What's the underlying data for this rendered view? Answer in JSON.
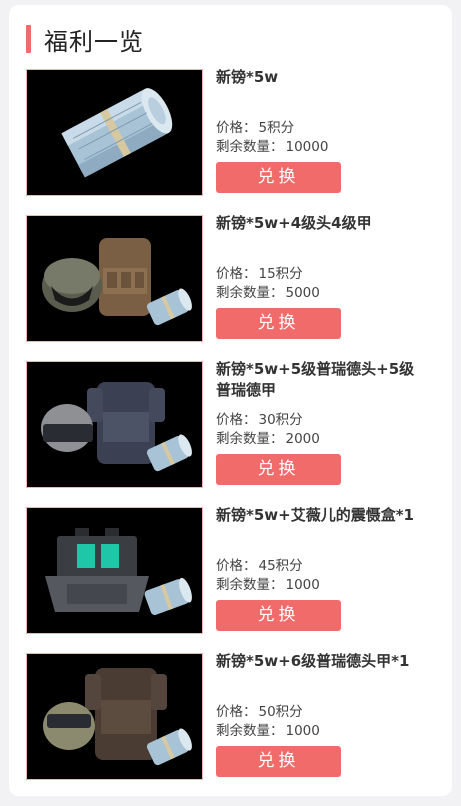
{
  "header": {
    "title": "福利一览"
  },
  "labels": {
    "price": "价格：",
    "stock": "剩余数量："
  },
  "items": [
    {
      "name": "新镑*5w",
      "price": "5积分",
      "stock": "10000",
      "button": "兑换",
      "image": "money-roll-icon"
    },
    {
      "name": "新镑*5w+4级头4级甲",
      "price": "15积分",
      "stock": "5000",
      "button": "兑换",
      "image": "helmet-armor-money-icon"
    },
    {
      "name": "新镑*5w+5级普瑞德头+5级普瑞德甲",
      "price": "30积分",
      "stock": "2000",
      "button": "兑换",
      "image": "helmet-armor-money-icon"
    },
    {
      "name": "新镑*5w+艾薇儿的震慑盒*1",
      "price": "45积分",
      "stock": "1000",
      "button": "兑换",
      "image": "case-money-icon"
    },
    {
      "name": "新镑*5w+6级普瑞德头甲*1",
      "price": "50积分",
      "stock": "1000",
      "button": "兑换",
      "image": "helmet-armor-money-icon"
    }
  ],
  "colors": {
    "accent": "#f26b6b",
    "thumb_bg": "#000000",
    "thumb_border": "#f4b3b3"
  }
}
